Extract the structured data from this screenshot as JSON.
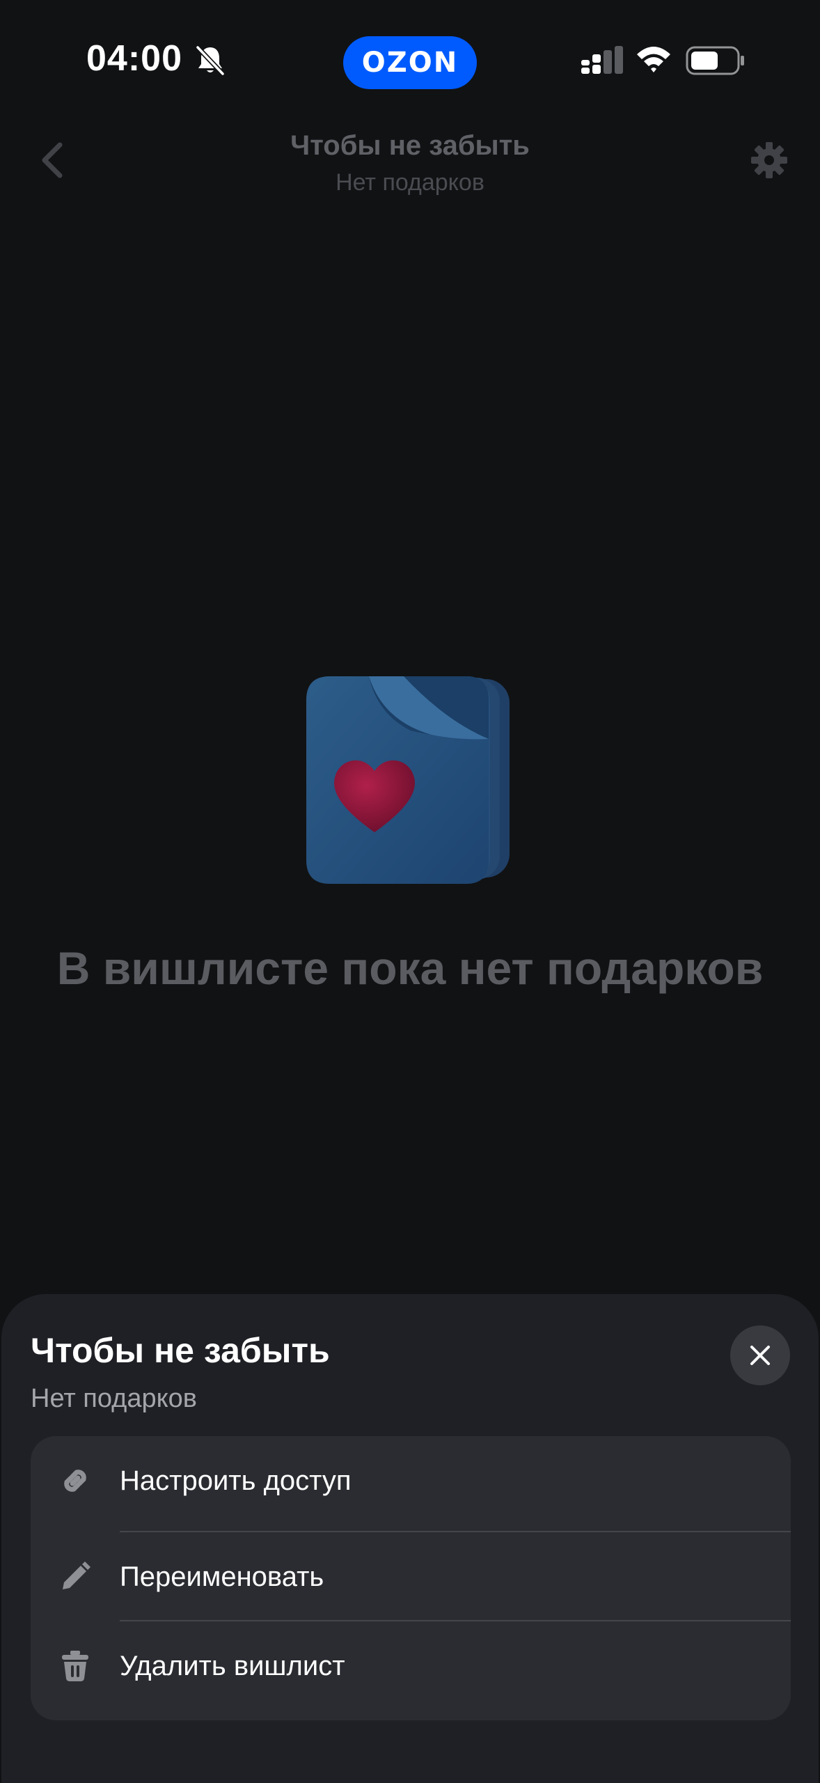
{
  "status_bar": {
    "time": "04:00",
    "app_badge": "OZON"
  },
  "header": {
    "title": "Чтобы не забыть",
    "subtitle": "Нет подарков"
  },
  "empty_state": {
    "title": "В вишлисте пока нет подарков"
  },
  "sheet": {
    "title": "Чтобы не забыть",
    "subtitle": "Нет подарков",
    "items": [
      {
        "label": "Настроить доступ",
        "icon": "link-icon"
      },
      {
        "label": "Переименовать",
        "icon": "pencil-icon"
      },
      {
        "label": "Удалить вишлист",
        "icon": "trash-icon"
      }
    ]
  },
  "colors": {
    "background": "#111214",
    "sheet": "#1f2025",
    "card": "#2a2c31",
    "brand": "#005bff"
  }
}
